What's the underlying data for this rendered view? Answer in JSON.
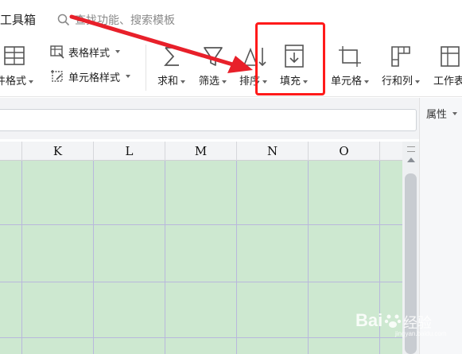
{
  "topbar": {
    "tab_title": "工具箱",
    "search_placeholder": "查找功能、搜索模板"
  },
  "ribbon": {
    "table_style_label": "表格样式",
    "cell_style_label": "单元格样式",
    "cond_format_label": "件格式",
    "sum_label": "求和",
    "filter_label": "筛选",
    "sort_label": "排序",
    "fill_label": "填充",
    "cell_label": "单元格",
    "rowcol_label": "行和列",
    "worksheet_label": "工作表"
  },
  "right_panel": {
    "title": "属性"
  },
  "grid": {
    "columns": [
      "K",
      "L",
      "M",
      "N",
      "O"
    ]
  },
  "watermark": {
    "brand": "Bai",
    "brand_cn": "经验",
    "sub": "jingyan.baidu.com"
  },
  "colors": {
    "highlight": "#ff1a1a",
    "arrow": "#e8202a",
    "grid_fill": "#cde8d0",
    "grid_lines": "#b9b8dc"
  }
}
